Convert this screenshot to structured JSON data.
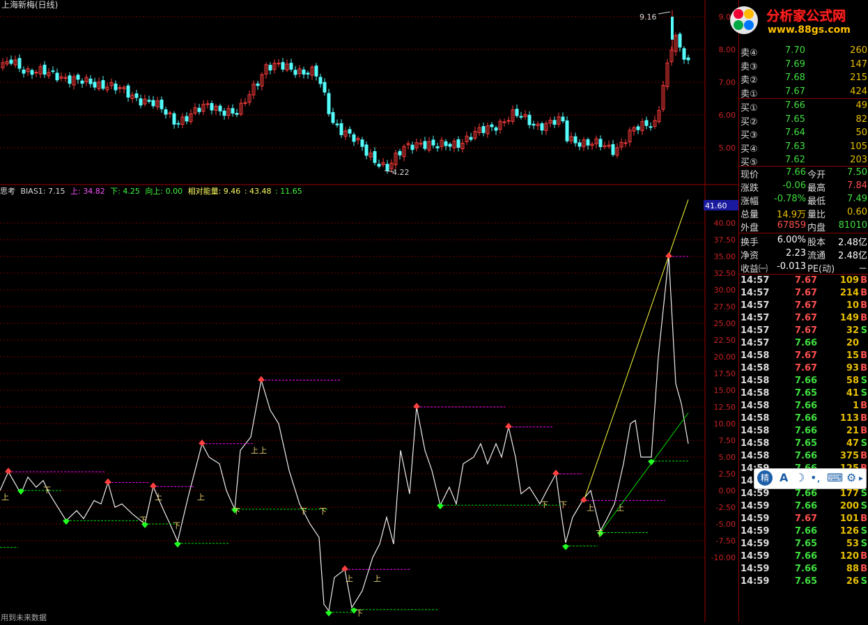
{
  "window_title": "上海新梅(日线)",
  "price_chart": {
    "max_label": "9.16",
    "min_label": "4.22",
    "y_ticks": [
      "9.00",
      "8.00",
      "7.00",
      "6.00",
      "5.00"
    ]
  },
  "indicator": {
    "name": "思考",
    "bias1_label": "BIAS1: 7.15",
    "up_label": "上: 34.82",
    "down_label": "下: 4.25",
    "upward_label": "向上: 0.00",
    "relative_energy": "相对能量: 9.46",
    "value_a": ": 43.48",
    "value_b": ": 11.65",
    "current_value": "41.60",
    "y_ticks": [
      "40.00",
      "37.50",
      "35.00",
      "32.50",
      "30.00",
      "27.50",
      "25.00",
      "22.50",
      "20.00",
      "17.50",
      "15.00",
      "12.50",
      "10.00",
      "7.50",
      "5.00",
      "2.50",
      "0.00",
      "-2.50",
      "-5.00",
      "-7.50",
      "-10.00"
    ],
    "up_marker": "上",
    "down_marker": "下"
  },
  "footer_text": "用到未来数据",
  "logo": {
    "text": "分析家公式网",
    "url_text": "www.88gs.com"
  },
  "colors": {
    "up": "#ff3c3c",
    "down": "#54fcfc",
    "green": "#00e000",
    "magenta": "#ff00ff",
    "yellow": "#ffff40",
    "grid": "#7a0000"
  },
  "quote_panel": {
    "asks": [
      {
        "label": "卖④",
        "price": "7.70",
        "vol": "260"
      },
      {
        "label": "卖③",
        "price": "7.69",
        "vol": "147"
      },
      {
        "label": "卖②",
        "price": "7.68",
        "vol": "215"
      },
      {
        "label": "卖①",
        "price": "7.67",
        "vol": "424"
      }
    ],
    "bids": [
      {
        "label": "买①",
        "price": "7.66",
        "vol": "49"
      },
      {
        "label": "买②",
        "price": "7.65",
        "vol": "82"
      },
      {
        "label": "买③",
        "price": "7.64",
        "vol": "50"
      },
      {
        "label": "买④",
        "price": "7.63",
        "vol": "105"
      },
      {
        "label": "买⑤",
        "price": "7.62",
        "vol": "203"
      }
    ],
    "stats": [
      {
        "l1": "现价",
        "v1": "7.66",
        "l2": "今开",
        "v2": "7.50"
      },
      {
        "l1": "涨跌",
        "v1": "-0.06",
        "l2": "最高",
        "v2": "7.84"
      },
      {
        "l1": "涨幅",
        "v1": "-0.78%",
        "l2": "最低",
        "v2": "7.49"
      },
      {
        "l1": "总量",
        "v1": "14.9万",
        "l2": "量比",
        "v2": "0.60"
      },
      {
        "l1": "外盘",
        "v1": "67859",
        "l2": "内盘",
        "v2": "81010"
      },
      {
        "l1": "换手",
        "v1": "6.00%",
        "l2": "股本",
        "v2": "2.48亿"
      },
      {
        "l1": "净资",
        "v1": "2.23",
        "l2": "流通",
        "v2": "2.48亿"
      },
      {
        "l1": "收益㈠",
        "v1": "-0.013",
        "l2": "PE(动)",
        "v2": "－"
      }
    ],
    "ticks": [
      {
        "t": "14:57",
        "p": "7.67",
        "v": "109",
        "s": "B"
      },
      {
        "t": "14:57",
        "p": "7.67",
        "v": "214",
        "s": "B"
      },
      {
        "t": "14:57",
        "p": "7.67",
        "v": "10",
        "s": "B"
      },
      {
        "t": "14:57",
        "p": "7.67",
        "v": "149",
        "s": "B"
      },
      {
        "t": "14:57",
        "p": "7.67",
        "v": "32",
        "s": "S"
      },
      {
        "t": "14:57",
        "p": "7.66",
        "v": "20",
        "s": ""
      },
      {
        "t": "14:58",
        "p": "7.67",
        "v": "15",
        "s": "B"
      },
      {
        "t": "14:58",
        "p": "7.67",
        "v": "93",
        "s": "B"
      },
      {
        "t": "14:58",
        "p": "7.66",
        "v": "58",
        "s": "S"
      },
      {
        "t": "14:58",
        "p": "7.65",
        "v": "41",
        "s": "S"
      },
      {
        "t": "14:58",
        "p": "7.66",
        "v": "1",
        "s": "B"
      },
      {
        "t": "14:58",
        "p": "7.66",
        "v": "113",
        "s": "B"
      },
      {
        "t": "14:58",
        "p": "7.66",
        "v": "21",
        "s": "B"
      },
      {
        "t": "14:58",
        "p": "7.65",
        "v": "47",
        "s": "S"
      },
      {
        "t": "14:58",
        "p": "7.66",
        "v": "375",
        "s": "B"
      },
      {
        "t": "14:59",
        "p": "7.66",
        "v": "125",
        "s": "B"
      },
      {
        "t": "14:59",
        "p": "7.66",
        "v": "202",
        "s": "B"
      },
      {
        "t": "14:59",
        "p": "7.66",
        "v": "177",
        "s": "S"
      },
      {
        "t": "14:59",
        "p": "7.66",
        "v": "200",
        "s": "S"
      },
      {
        "t": "14:59",
        "p": "7.67",
        "v": "101",
        "s": "B"
      },
      {
        "t": "14:59",
        "p": "7.66",
        "v": "126",
        "s": "S"
      },
      {
        "t": "14:59",
        "p": "7.65",
        "v": "53",
        "s": "S"
      },
      {
        "t": "14:59",
        "p": "7.66",
        "v": "120",
        "s": "B"
      },
      {
        "t": "14:59",
        "p": "7.66",
        "v": "88",
        "s": "B"
      },
      {
        "t": "14:59",
        "p": "7.65",
        "v": "26",
        "s": "S"
      }
    ]
  },
  "ime_toolbar": {
    "brand_icon": "精",
    "mode_text": "A"
  }
}
